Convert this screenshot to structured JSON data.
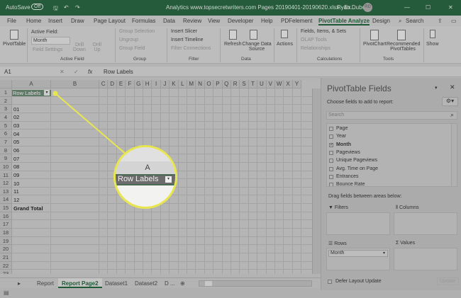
{
  "titlebar": {
    "autosave": "AutoSave",
    "toggle": "Off",
    "filename": "Analytics www.topsecretwriters.com Pages 20190401-20190620.xlsx - Ex...",
    "user": "Ryan Dube",
    "avatar": "RD"
  },
  "tabs": [
    "File",
    "Home",
    "Insert",
    "Draw",
    "Page Layout",
    "Formulas",
    "Data",
    "Review",
    "View",
    "Developer",
    "Help",
    "PDFelement",
    "PivotTable Analyze",
    "Design"
  ],
  "search": "Search",
  "ribbon": {
    "pivottable": "PivotTable",
    "active_field_label": "Active Field:",
    "active_field_value": "Month",
    "field_settings": "Field Settings",
    "drill_down": "Drill Down",
    "drill_up": "Drill Up",
    "group_active": "Active Field",
    "group_selection": "Group Selection",
    "ungroup": "Ungroup",
    "group_field": "Group Field",
    "group_group": "Group",
    "insert_slicer": "Insert Slicer",
    "insert_timeline": "Insert Timeline",
    "filter_connections": "Filter Connections",
    "group_filter": "Filter",
    "refresh": "Refresh",
    "change_source": "Change Data Source",
    "group_data": "Data",
    "actions": "Actions",
    "fields_items": "Fields, Items, & Sets",
    "olap": "OLAP Tools",
    "relationships": "Relationships",
    "group_calc": "Calculations",
    "pivotchart": "PivotChart",
    "recommended": "Recommended PivotTables",
    "group_tools": "Tools",
    "show": "Show"
  },
  "formula": {
    "namebox": "A1",
    "fx": "fx",
    "content": "Row Labels"
  },
  "grid": {
    "columns": [
      "A",
      "B",
      "C",
      "D",
      "E",
      "F",
      "G",
      "H",
      "I",
      "J",
      "K",
      "L",
      "M",
      "N",
      "O",
      "P",
      "Q",
      "R",
      "S",
      "T",
      "U",
      "V",
      "W",
      "X",
      "Y"
    ],
    "cells_a": [
      "Row Labels",
      "",
      "01",
      "02",
      "03",
      "04",
      "05",
      "06",
      "07",
      "08",
      "09",
      "10",
      "11",
      "12",
      "Grand Total",
      "",
      "",
      "",
      "",
      "",
      "",
      "",
      ""
    ]
  },
  "magnifier": {
    "column": "A",
    "cell": "Row Labels"
  },
  "sheets": [
    "Report",
    "Report Page2",
    "Dataset1",
    "Dataset2",
    "D ..."
  ],
  "active_sheet": "Report Page2",
  "panel": {
    "title": "PivotTable Fields",
    "choose": "Choose fields to add to report:",
    "search_placeholder": "Search",
    "fields": [
      {
        "name": "Page",
        "checked": false
      },
      {
        "name": "Year",
        "checked": false
      },
      {
        "name": "Month",
        "checked": true
      },
      {
        "name": "Pageviews",
        "checked": false
      },
      {
        "name": "Unique Pageviews",
        "checked": false
      },
      {
        "name": "Avg. Time on Page",
        "checked": false
      },
      {
        "name": "Entrances",
        "checked": false
      },
      {
        "name": "Bounce Rate",
        "checked": false
      }
    ],
    "drag": "Drag fields between areas below:",
    "filters": "Filters",
    "columns": "Columns",
    "rows": "Rows",
    "values": "Values",
    "row_item": "Month",
    "defer": "Defer Layout Update",
    "update": "Update"
  }
}
